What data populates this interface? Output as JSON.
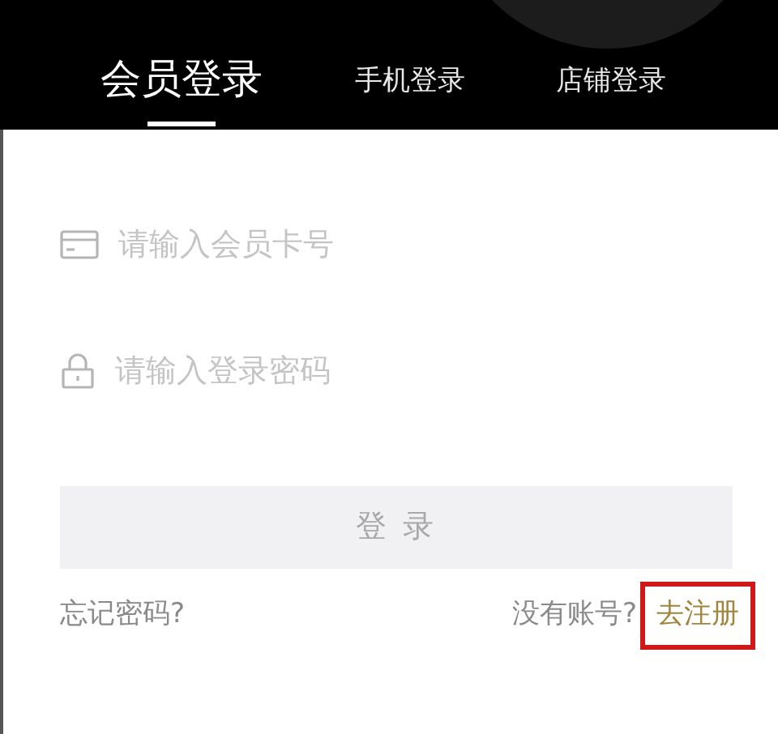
{
  "tabs": [
    {
      "label": "会员登录",
      "selected": true
    },
    {
      "label": "手机登录",
      "selected": false
    },
    {
      "label": "店铺登录",
      "selected": false
    }
  ],
  "fields": [
    {
      "kind": "card",
      "placeholder": "请输入会员卡号"
    },
    {
      "kind": "password",
      "placeholder": "请输入登录密码"
    }
  ],
  "login_button": {
    "label": "登 录",
    "disabled": true
  },
  "forgot_password": "忘记密码?",
  "register_prompt": "没有账号?",
  "register_link": {
    "label": "去注册",
    "highlighted": true
  }
}
